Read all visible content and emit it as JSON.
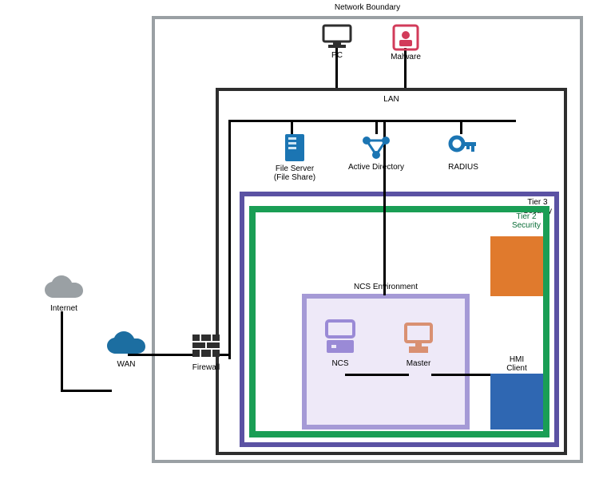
{
  "boundary": {
    "label": "Network Boundary"
  },
  "zones": {
    "lan": {
      "label": "LAN"
    },
    "tier3": {
      "label": "Tier 3\nSecurity"
    },
    "tier2": {
      "label": "Tier 2\nSecurity"
    },
    "ncs": {
      "label": "NCS Environment"
    },
    "hmi": {
      "label": "HMI\nClient"
    }
  },
  "nodes": {
    "internet": {
      "label": "Internet",
      "icon": "cloud",
      "color": "#9aa0a4"
    },
    "wan": {
      "label": "WAN",
      "icon": "cloud",
      "color": "#1c6ea1"
    },
    "firewall": {
      "label": "Firewall",
      "icon": "firewall",
      "color": "#2e2e2e"
    },
    "pc": {
      "label": "PC",
      "icon": "pc",
      "color": "#2e2e2e"
    },
    "malware": {
      "label": "Malware",
      "icon": "malware",
      "color": "#d23b5a"
    },
    "fileserver": {
      "label": "File Server\n(File Share)",
      "icon": "server",
      "color": "#1b75b3"
    },
    "ad": {
      "label": "Active Directory",
      "icon": "ad",
      "color": "#1b75b3"
    },
    "radius": {
      "label": "RADIUS",
      "icon": "key",
      "color": "#1b75b3"
    },
    "ncs_node": {
      "label": "NCS",
      "icon": "appliance",
      "color": "#9a8ad6"
    },
    "master": {
      "label": "Master",
      "icon": "pc",
      "color": "#d99072"
    }
  },
  "colors": {
    "boundary": "#9aa0a4",
    "lan": "#2e2e2e",
    "tier3": "#5b52a3",
    "tier2": "#1a9e55",
    "ncs_env": "#a59ad6",
    "ncs_env_fill": "#e6e0f4",
    "hmi_top": "#e07a2d",
    "hmi_bot": "#2f67b2",
    "link": "#000000"
  }
}
